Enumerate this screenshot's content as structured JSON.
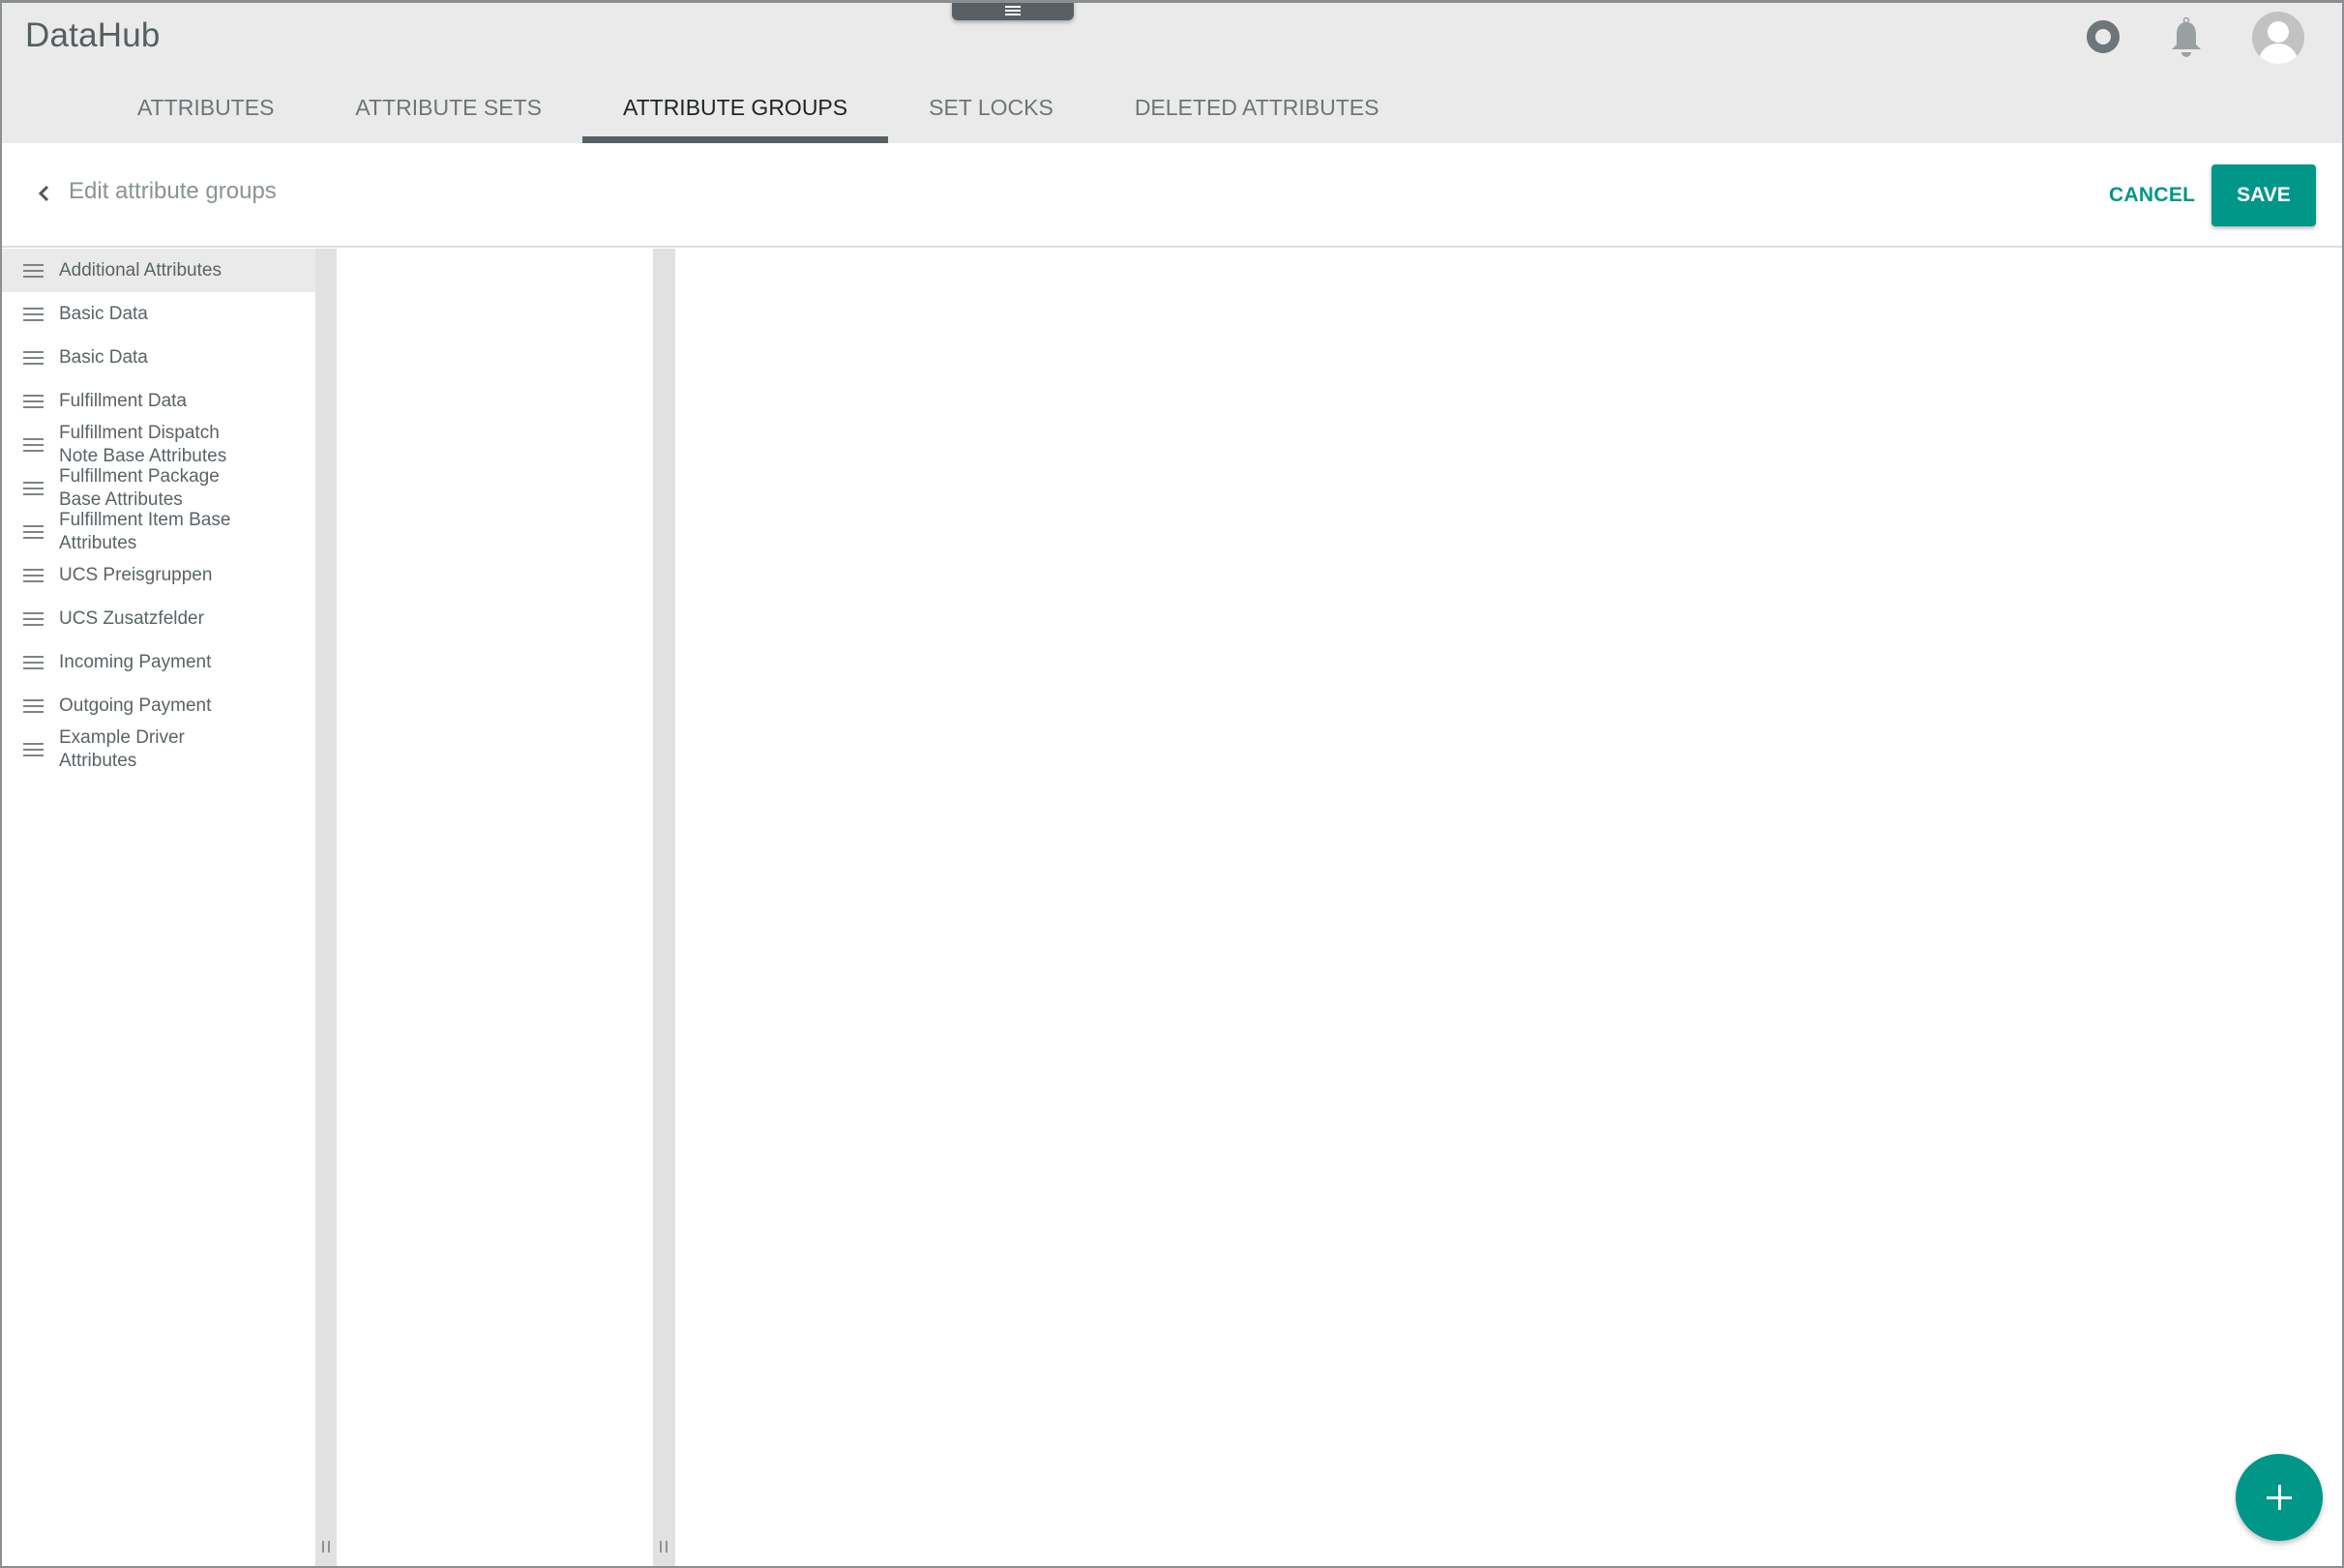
{
  "header": {
    "app_title": "DataHub",
    "drawer_handle_icon": "menu-lines-icon",
    "icons": [
      "status-ring-icon",
      "bell-icon",
      "user-avatar-icon"
    ]
  },
  "tabs": [
    {
      "label": "ATTRIBUTES",
      "active": false
    },
    {
      "label": "ATTRIBUTE SETS",
      "active": false
    },
    {
      "label": "ATTRIBUTE GROUPS",
      "active": true
    },
    {
      "label": "SET LOCKS",
      "active": false
    },
    {
      "label": "DELETED ATTRIBUTES",
      "active": false
    }
  ],
  "toolbar": {
    "title": "Edit attribute groups",
    "back_icon": "chevron-left-icon",
    "cancel_label": "CANCEL",
    "save_label": "SAVE"
  },
  "groups": [
    {
      "label": "Additional Attributes",
      "selected": true
    },
    {
      "label": "Basic Data"
    },
    {
      "label": "Basic Data"
    },
    {
      "label": "Fulfillment Data"
    },
    {
      "label": "Fulfillment Dispatch Note Base Attributes"
    },
    {
      "label": "Fulfillment Package Base Attributes"
    },
    {
      "label": "Fulfillment Item Base Attributes"
    },
    {
      "label": "UCS Preisgruppen"
    },
    {
      "label": "UCS Zusatzfelder"
    },
    {
      "label": "Incoming Payment"
    },
    {
      "label": "Outgoing Payment"
    },
    {
      "label": "Example Driver Attributes"
    }
  ],
  "fab": {
    "icon": "plus-icon"
  },
  "colors": {
    "accent": "#009688",
    "header_bg": "#eaeaea",
    "tab_indicator": "#586064",
    "splitter": "#e1e1e1"
  }
}
